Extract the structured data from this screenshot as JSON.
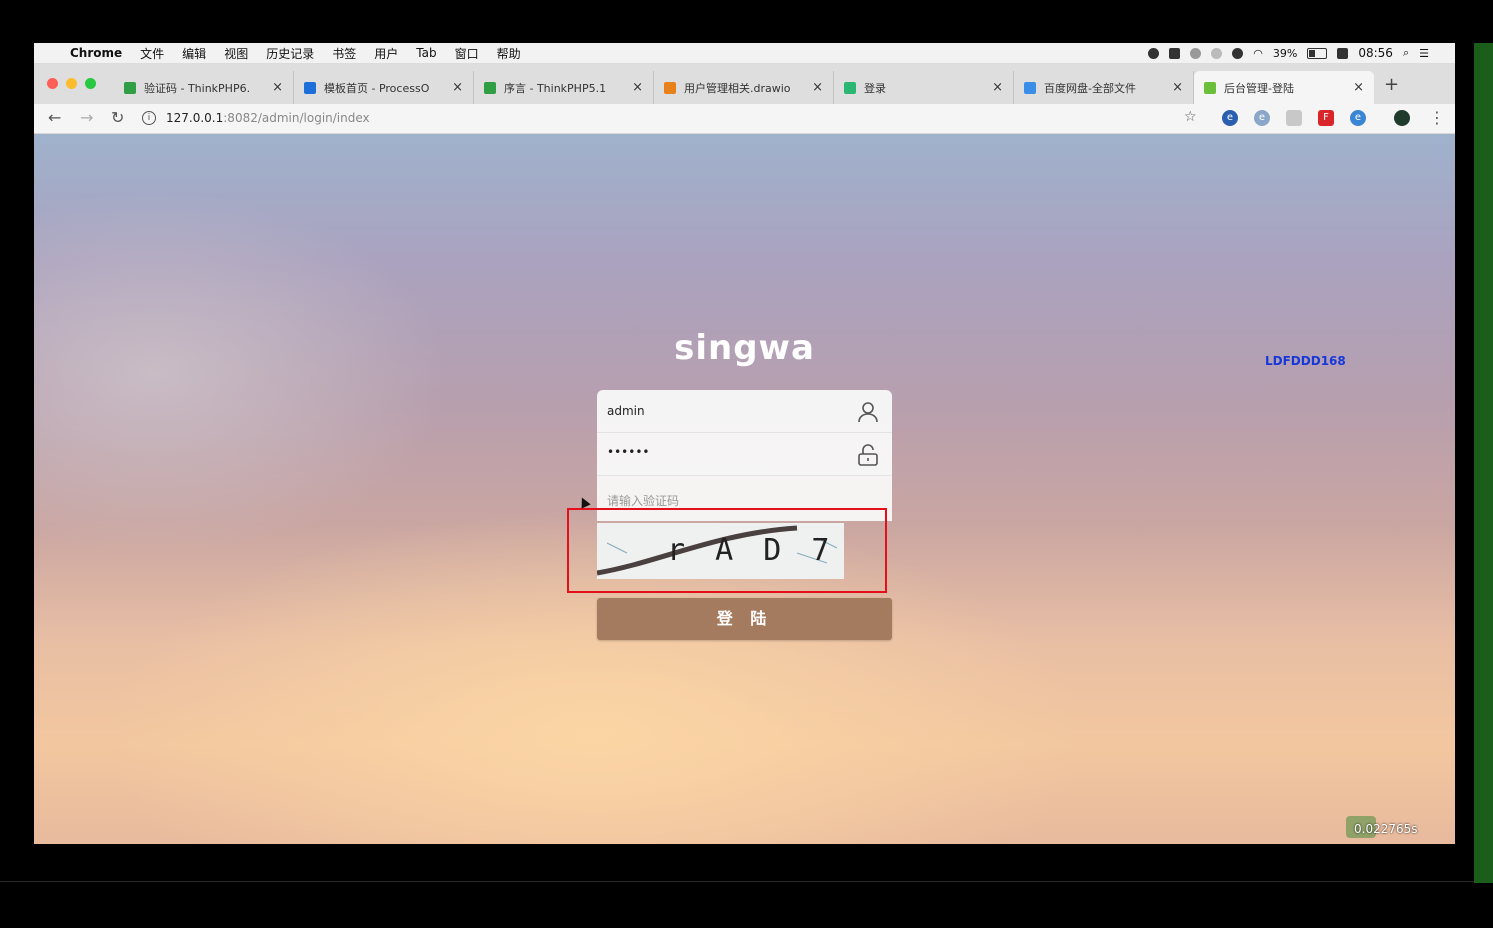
{
  "menubar": {
    "app": "Chrome",
    "items": [
      "文件",
      "编辑",
      "视图",
      "历史记录",
      "书签",
      "用户",
      "Tab",
      "窗口",
      "帮助"
    ],
    "battery": "39%",
    "clock": "08:56"
  },
  "tabs": [
    {
      "label": "验证码 - ThinkPHP6.",
      "icon_color": "#2f9e44"
    },
    {
      "label": "模板首页 - ProcessO",
      "icon_color": "#1e6fd9"
    },
    {
      "label": "序言 - ThinkPHP5.1",
      "icon_color": "#2f9e44"
    },
    {
      "label": "用户管理相关.drawio",
      "icon_color": "#e8811a"
    },
    {
      "label": "登录",
      "icon_color": "#2bb673"
    },
    {
      "label": "百度网盘-全部文件",
      "icon_color": "#3b8ee8"
    },
    {
      "label": "后台管理-登陆",
      "icon_color": "#6cbf3a"
    }
  ],
  "address_bar": {
    "host": "127.0.0.1",
    "path": ":8082/admin/login/index"
  },
  "page": {
    "brand": "singwa",
    "side_code": "LDFDDD168",
    "username_value": "admin",
    "password_value": "••••••",
    "captcha_placeholder": "请输入验证码",
    "captcha_text": "r A D 7",
    "login_button": "登 陆",
    "timer": "0.022765s"
  },
  "colors": {
    "login_button": "#a57b5f",
    "highlight": "#e3101c",
    "side_code": "#1638d8"
  }
}
